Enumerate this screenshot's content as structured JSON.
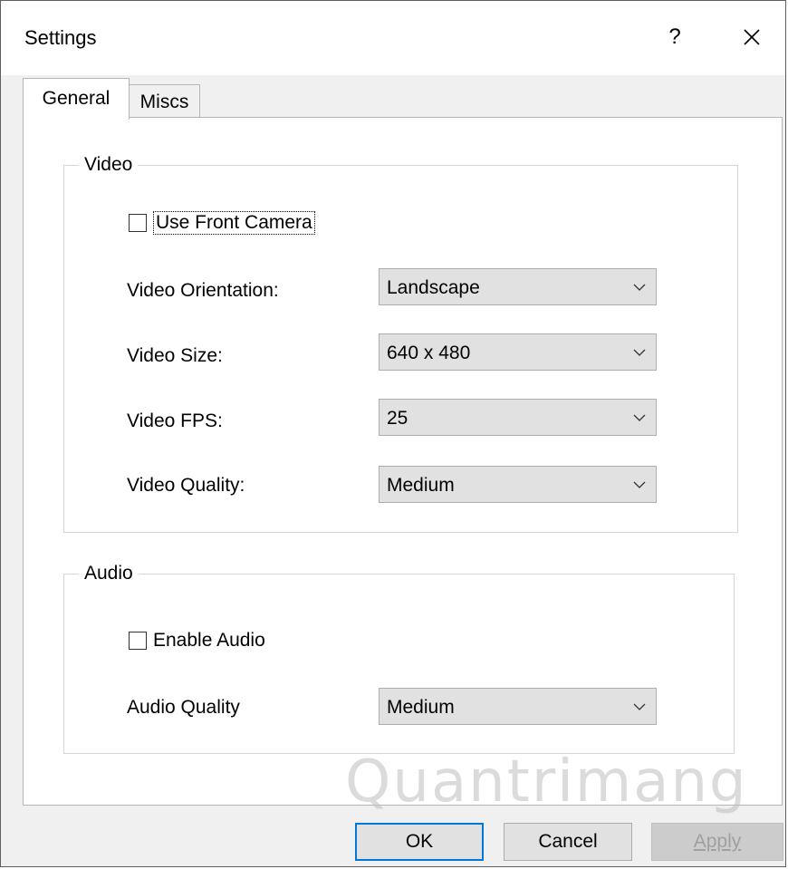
{
  "window": {
    "title": "Settings",
    "help_label": "?"
  },
  "tabs": [
    {
      "label": "General",
      "selected": true
    },
    {
      "label": "Miscs",
      "selected": false
    }
  ],
  "video_group": {
    "legend": "Video",
    "front_camera": {
      "label": "Use Front Camera",
      "checked": false
    },
    "orientation": {
      "label": "Video Orientation:",
      "value": "Landscape"
    },
    "size": {
      "label": "Video Size:",
      "value": "640 x 480"
    },
    "fps": {
      "label": "Video FPS:",
      "value": "25"
    },
    "quality": {
      "label": "Video Quality:",
      "value": "Medium"
    }
  },
  "audio_group": {
    "legend": "Audio",
    "enable_audio": {
      "label": "Enable Audio",
      "checked": false
    },
    "quality": {
      "label": "Audio Quality",
      "value": "Medium"
    }
  },
  "buttons": {
    "ok": "OK",
    "cancel": "Cancel",
    "apply": "Apply",
    "apply_enabled": false
  },
  "watermark": "Quantrimang",
  "colors": {
    "focus_border": "#0078d7",
    "combo_bg": "#e1e1e1",
    "dialog_bg": "#f0f0f0"
  }
}
